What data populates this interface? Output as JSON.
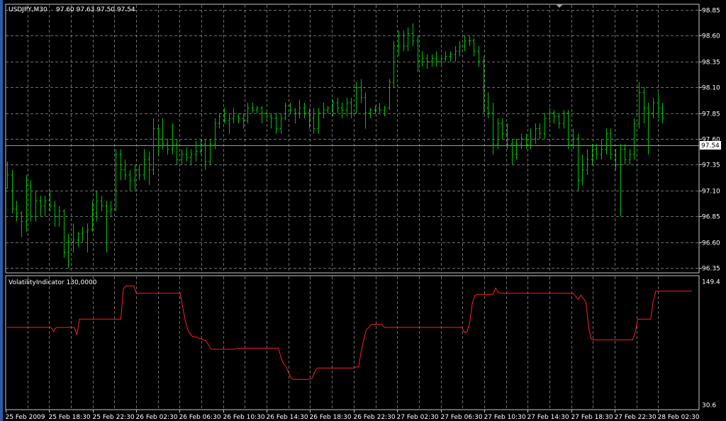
{
  "window": {
    "symbol_label": "USDJPY,M30",
    "ohlc_label": "97.60 97.63 97.50 97.54",
    "indicator_label": "VolatilityIndicator 130,0000"
  },
  "colors": {
    "background": "#000000",
    "bars": "#00c000",
    "indicator": "#ff1f1f",
    "grid": "#6f6f6f",
    "axis_text": "#ffffff",
    "price_tag_bg": "#ffffff",
    "price_tag_text": "#000000"
  },
  "chart_data": [
    {
      "type": "ohlc",
      "title": "USDJPY,M30",
      "current_price": 97.54,
      "current_price_label": "97.54",
      "ylim": [
        96.35,
        98.85
      ],
      "yticks": [
        "98.85",
        "98.60",
        "98.35",
        "98.10",
        "97.85",
        "97.60",
        "97.35",
        "97.10",
        "96.85",
        "96.60",
        "96.35"
      ],
      "grid": true,
      "x_labels": [
        "25 Feb 2009",
        "25 Feb 18:30",
        "25 Feb 22:30",
        "26 Feb 02:30",
        "26 Feb 06:30",
        "26 Feb 10:30",
        "26 Feb 14:30",
        "26 Feb 18:30",
        "26 Feb 22:30",
        "27 Feb 02:30",
        "27 Feb 06:30",
        "27 Feb 10:30",
        "27 Feb 14:30",
        "27 Feb 18:30",
        "27 Feb 22:30",
        "28 Feb 02:30"
      ],
      "bars": [
        [
          97.12,
          97.38,
          97.12,
          97.25
        ],
        [
          97.25,
          97.3,
          96.88,
          96.92
        ],
        [
          96.92,
          97.0,
          96.8,
          96.88
        ],
        [
          96.88,
          96.9,
          96.65,
          96.8
        ],
        [
          96.8,
          97.25,
          96.7,
          97.15
        ],
        [
          97.15,
          97.2,
          96.8,
          96.85
        ],
        [
          96.85,
          97.1,
          96.8,
          97.0
        ],
        [
          97.0,
          97.05,
          96.85,
          96.95
        ],
        [
          96.95,
          97.05,
          96.85,
          97.0
        ],
        [
          97.0,
          97.1,
          96.9,
          96.95
        ],
        [
          96.95,
          97.0,
          96.75,
          96.85
        ],
        [
          96.85,
          96.95,
          96.75,
          96.9
        ],
        [
          96.9,
          96.92,
          96.45,
          96.5
        ],
        [
          96.5,
          96.68,
          96.35,
          96.6
        ],
        [
          96.6,
          96.78,
          96.5,
          96.62
        ],
        [
          96.62,
          96.7,
          96.55,
          96.68
        ],
        [
          96.68,
          96.75,
          96.6,
          96.7
        ],
        [
          96.7,
          96.78,
          96.5,
          96.72
        ],
        [
          96.72,
          97.0,
          96.7,
          96.88
        ],
        [
          96.88,
          97.1,
          96.8,
          97.0
        ],
        [
          97.0,
          97.05,
          96.9,
          96.95
        ],
        [
          96.95,
          97.0,
          96.5,
          96.9
        ],
        [
          96.9,
          97.0,
          96.85,
          96.92
        ],
        [
          96.92,
          97.5,
          96.9,
          97.45
        ],
        [
          97.45,
          97.5,
          97.2,
          97.3
        ],
        [
          97.3,
          97.4,
          97.2,
          97.25
        ],
        [
          97.25,
          97.3,
          97.1,
          97.2
        ],
        [
          97.2,
          97.35,
          97.1,
          97.3
        ],
        [
          97.3,
          97.35,
          97.2,
          97.25
        ],
        [
          97.25,
          97.5,
          97.2,
          97.4
        ],
        [
          97.4,
          97.48,
          97.15,
          97.3
        ],
        [
          97.3,
          97.8,
          97.25,
          97.7
        ],
        [
          97.7,
          97.72,
          97.45,
          97.6
        ],
        [
          97.6,
          97.8,
          97.5,
          97.55
        ],
        [
          97.55,
          97.6,
          97.45,
          97.5
        ],
        [
          97.5,
          97.75,
          97.45,
          97.55
        ],
        [
          97.55,
          97.6,
          97.35,
          97.4
        ],
        [
          97.4,
          97.5,
          97.35,
          97.45
        ],
        [
          97.45,
          97.52,
          97.38,
          97.42
        ],
        [
          97.42,
          97.5,
          97.35,
          97.45
        ],
        [
          97.45,
          97.58,
          97.38,
          97.48
        ],
        [
          97.48,
          97.6,
          97.45,
          97.55
        ],
        [
          97.55,
          97.6,
          97.3,
          97.38
        ],
        [
          97.38,
          97.6,
          97.35,
          97.55
        ],
        [
          97.55,
          97.8,
          97.5,
          97.75
        ],
        [
          97.75,
          97.85,
          97.7,
          97.82
        ],
        [
          97.82,
          97.9,
          97.75,
          97.78
        ],
        [
          97.78,
          97.85,
          97.65,
          97.8
        ],
        [
          97.8,
          97.9,
          97.75,
          97.82
        ],
        [
          97.82,
          97.85,
          97.75,
          97.8
        ],
        [
          97.8,
          97.85,
          97.7,
          97.78
        ],
        [
          97.78,
          97.95,
          97.75,
          97.9
        ],
        [
          97.9,
          97.95,
          97.85,
          97.88
        ],
        [
          97.88,
          97.92,
          97.85,
          97.9
        ],
        [
          97.9,
          97.92,
          97.75,
          97.85
        ],
        [
          97.85,
          97.88,
          97.8,
          97.82
        ],
        [
          97.82,
          97.85,
          97.7,
          97.8
        ],
        [
          97.8,
          97.85,
          97.65,
          97.7
        ],
        [
          97.7,
          97.85,
          97.65,
          97.8
        ],
        [
          97.8,
          97.95,
          97.78,
          97.92
        ],
        [
          97.92,
          97.95,
          97.85,
          97.88
        ],
        [
          97.88,
          97.9,
          97.75,
          97.85
        ],
        [
          97.85,
          97.98,
          97.8,
          97.9
        ],
        [
          97.9,
          97.95,
          97.8,
          97.85
        ],
        [
          97.85,
          97.9,
          97.7,
          97.8
        ],
        [
          97.8,
          97.9,
          97.65,
          97.7
        ],
        [
          97.7,
          97.9,
          97.65,
          97.85
        ],
        [
          97.85,
          97.95,
          97.8,
          97.88
        ],
        [
          97.88,
          97.92,
          97.85,
          97.9
        ],
        [
          97.9,
          97.98,
          97.82,
          97.95
        ],
        [
          97.95,
          98.0,
          97.85,
          97.9
        ],
        [
          97.9,
          97.95,
          97.8,
          97.88
        ],
        [
          97.88,
          98.0,
          97.82,
          97.95
        ],
        [
          97.95,
          98.0,
          97.8,
          97.85
        ],
        [
          97.85,
          98.15,
          97.85,
          98.1
        ],
        [
          98.1,
          98.18,
          97.95,
          98.0
        ],
        [
          98.0,
          98.05,
          97.7,
          97.85
        ],
        [
          97.85,
          97.9,
          97.8,
          97.88
        ],
        [
          97.88,
          97.92,
          97.85,
          97.9
        ],
        [
          97.9,
          97.95,
          97.85,
          97.88
        ],
        [
          97.88,
          97.92,
          97.82,
          97.9
        ],
        [
          97.9,
          98.18,
          97.88,
          98.15
        ],
        [
          98.15,
          98.55,
          98.1,
          98.5
        ],
        [
          98.5,
          98.65,
          98.4,
          98.6
        ],
        [
          98.6,
          98.65,
          98.45,
          98.5
        ],
        [
          98.5,
          98.68,
          98.45,
          98.62
        ],
        [
          98.62,
          98.72,
          98.5,
          98.55
        ],
        [
          98.55,
          98.6,
          98.25,
          98.35
        ],
        [
          98.35,
          98.45,
          98.3,
          98.38
        ],
        [
          98.38,
          98.42,
          98.28,
          98.35
        ],
        [
          98.35,
          98.42,
          98.3,
          98.38
        ],
        [
          98.38,
          98.45,
          98.3,
          98.35
        ],
        [
          98.35,
          98.42,
          98.3,
          98.38
        ],
        [
          98.38,
          98.45,
          98.35,
          98.4
        ],
        [
          98.4,
          98.45,
          98.35,
          98.42
        ],
        [
          98.42,
          98.5,
          98.35,
          98.45
        ],
        [
          98.45,
          98.55,
          98.4,
          98.5
        ],
        [
          98.5,
          98.6,
          98.45,
          98.55
        ],
        [
          98.55,
          98.6,
          98.5,
          98.55
        ],
        [
          98.55,
          98.58,
          98.4,
          98.45
        ],
        [
          98.45,
          98.5,
          98.3,
          98.35
        ],
        [
          98.35,
          98.4,
          97.85,
          97.9
        ],
        [
          97.9,
          98.05,
          97.8,
          97.85
        ],
        [
          97.85,
          97.95,
          97.45,
          97.55
        ],
        [
          97.55,
          97.8,
          97.5,
          97.75
        ],
        [
          97.75,
          97.8,
          97.6,
          97.65
        ],
        [
          97.65,
          97.75,
          97.5,
          97.55
        ],
        [
          97.55,
          97.6,
          97.35,
          97.45
        ],
        [
          97.45,
          97.6,
          97.4,
          97.55
        ],
        [
          97.55,
          97.65,
          97.5,
          97.6
        ],
        [
          97.6,
          97.65,
          97.5,
          97.55
        ],
        [
          97.55,
          97.7,
          97.5,
          97.6
        ],
        [
          97.6,
          97.75,
          97.55,
          97.7
        ],
        [
          97.7,
          97.75,
          97.6,
          97.65
        ],
        [
          97.65,
          97.85,
          97.6,
          97.8
        ],
        [
          97.8,
          97.9,
          97.75,
          97.85
        ],
        [
          97.85,
          97.88,
          97.75,
          97.82
        ],
        [
          97.82,
          97.85,
          97.7,
          97.75
        ],
        [
          97.75,
          97.88,
          97.7,
          97.85
        ],
        [
          97.85,
          97.88,
          97.5,
          97.55
        ],
        [
          97.55,
          97.7,
          97.5,
          97.6
        ],
        [
          97.6,
          97.65,
          97.1,
          97.2
        ],
        [
          97.2,
          97.45,
          97.15,
          97.3
        ],
        [
          97.3,
          97.5,
          97.25,
          97.4
        ],
        [
          97.4,
          97.55,
          97.35,
          97.5
        ],
        [
          97.5,
          97.55,
          97.4,
          97.45
        ],
        [
          97.45,
          97.6,
          97.4,
          97.5
        ],
        [
          97.5,
          97.7,
          97.45,
          97.65
        ],
        [
          97.65,
          97.7,
          97.4,
          97.45
        ],
        [
          97.45,
          97.5,
          97.3,
          97.35
        ],
        [
          97.35,
          97.55,
          96.85,
          97.5
        ],
        [
          97.5,
          97.55,
          97.35,
          97.4
        ],
        [
          97.4,
          97.5,
          97.35,
          97.45
        ],
        [
          97.45,
          97.8,
          97.4,
          97.75
        ],
        [
          97.75,
          98.15,
          97.7,
          98.05
        ],
        [
          98.05,
          98.1,
          97.75,
          97.9
        ],
        [
          97.9,
          97.95,
          97.45,
          97.85
        ],
        [
          97.85,
          98.0,
          97.8,
          97.95
        ],
        [
          97.95,
          98.05,
          97.8,
          97.9
        ],
        [
          97.9,
          97.95,
          97.75,
          97.8
        ]
      ]
    },
    {
      "type": "line",
      "title": "VolatilityIndicator 130,0000",
      "ylim": [
        30.6,
        149.4
      ],
      "yticks": [
        "149.4",
        "30.6"
      ],
      "series": [
        {
          "name": "",
          "values": [
            105,
            105,
            105,
            105,
            105,
            105,
            105,
            105,
            105,
            105,
            105,
            105,
            105,
            105,
            105,
            105,
            105,
            105,
            101,
            105,
            105,
            105,
            105,
            105,
            105,
            105,
            105,
            98,
            113,
            113,
            113,
            113,
            113,
            113,
            113,
            113,
            113,
            113,
            113,
            113,
            113,
            113,
            113,
            113,
            113,
            142,
            145,
            145,
            145,
            145,
            138,
            138,
            138,
            138,
            138,
            138,
            138,
            138,
            138,
            138,
            138,
            138,
            138,
            138,
            138,
            138,
            138,
            138,
            124,
            111,
            102,
            98,
            96,
            96,
            95,
            94,
            93,
            92,
            88,
            84,
            84,
            84,
            84,
            84,
            84,
            84,
            84,
            84,
            84,
            85,
            85,
            85,
            85,
            85,
            85,
            85,
            85,
            85,
            85,
            85,
            85,
            85,
            85,
            85,
            85,
            85,
            76,
            70,
            67,
            61,
            56,
            55,
            55,
            55,
            55,
            55,
            55,
            55,
            56,
            62,
            66,
            66,
            66,
            66,
            66,
            66,
            66,
            66,
            66,
            66,
            66,
            66,
            66,
            66,
            66,
            67,
            67,
            82,
            93,
            103,
            105,
            108,
            108,
            108,
            108,
            108,
            105,
            105,
            105,
            105,
            105,
            105,
            105,
            105,
            105,
            105,
            105,
            105,
            105,
            105,
            105,
            105,
            105,
            105,
            105,
            105,
            105,
            105,
            105,
            105,
            105,
            105,
            105,
            105,
            105,
            105,
            105,
            100,
            101,
            110,
            128,
            136,
            137,
            137,
            137,
            137,
            137,
            137,
            137,
            143,
            139,
            138,
            138,
            138,
            138,
            138,
            138,
            138,
            138,
            138,
            138,
            138,
            138,
            138,
            138,
            138,
            138,
            138,
            138,
            138,
            138,
            138,
            138,
            138,
            138,
            138,
            138,
            138,
            138,
            138,
            135,
            132,
            136,
            133,
            129,
            105,
            94,
            93,
            93,
            93,
            93,
            93,
            93,
            93,
            93,
            93,
            93,
            93,
            93,
            93,
            93,
            93,
            93,
            100,
            113,
            113,
            113,
            113,
            113,
            113,
            130,
            140,
            140,
            140,
            140,
            140,
            140,
            140,
            140,
            140,
            140,
            140,
            140,
            140,
            140,
            140
          ]
        }
      ]
    }
  ]
}
